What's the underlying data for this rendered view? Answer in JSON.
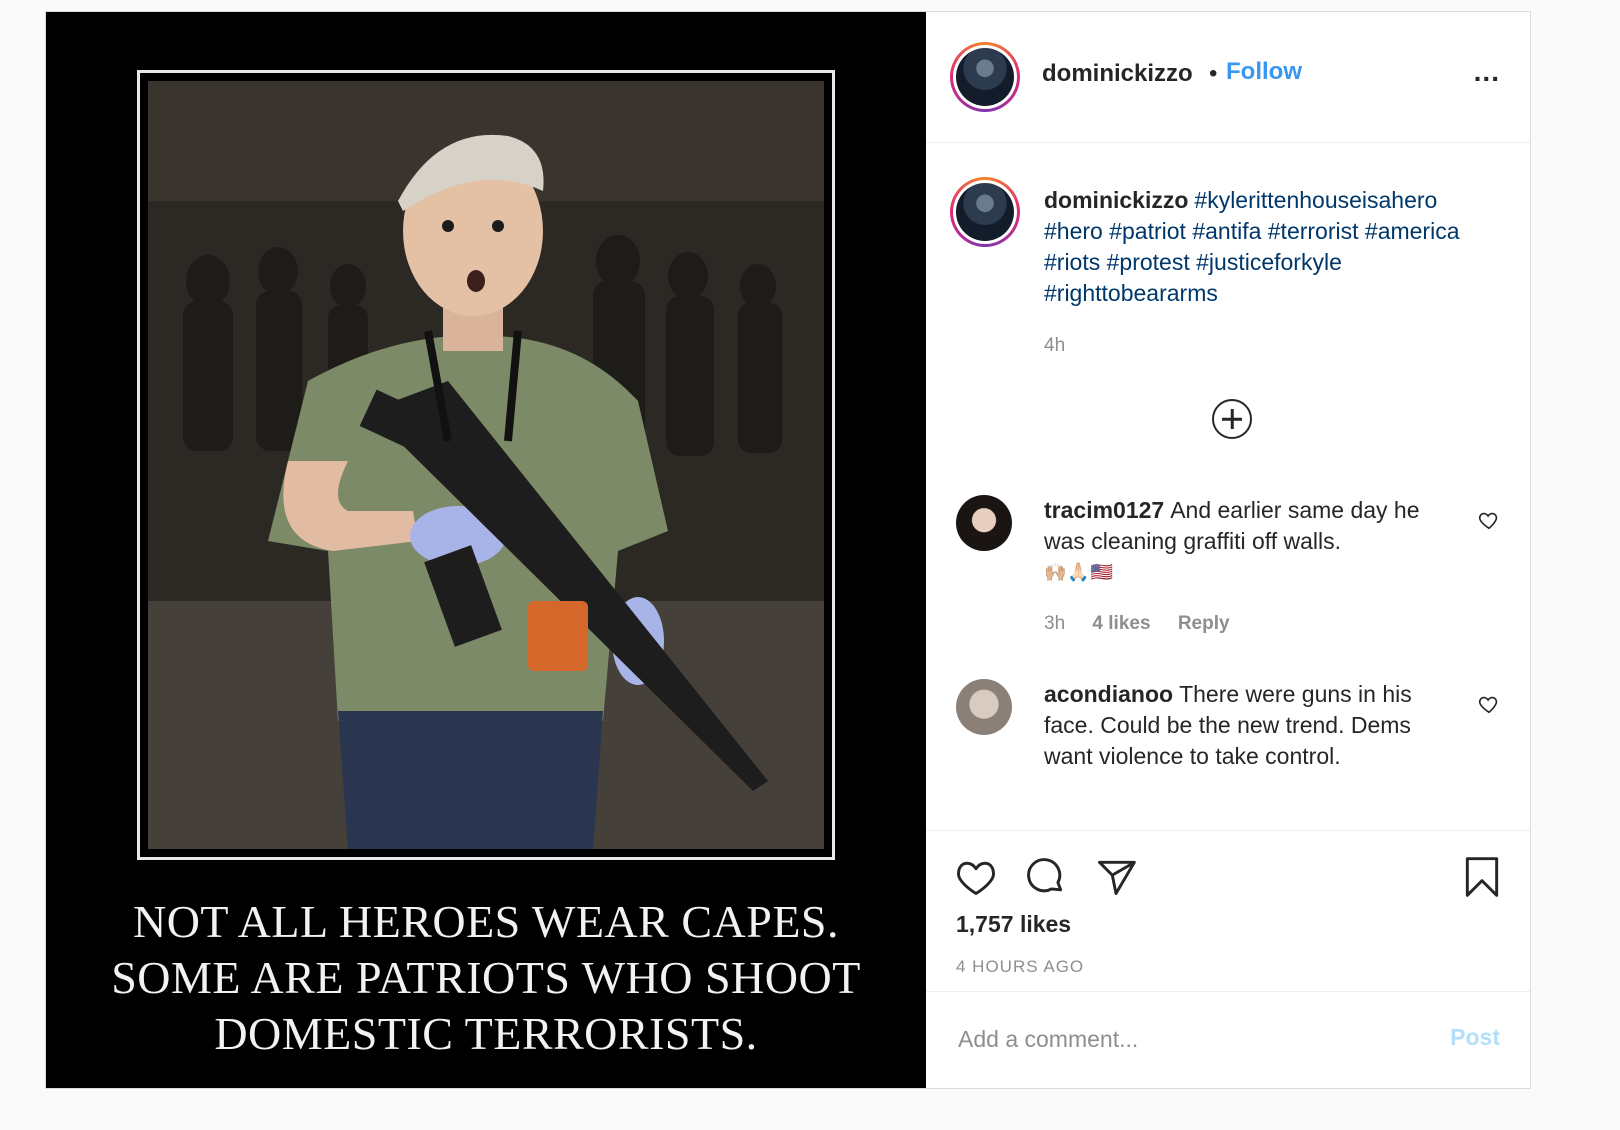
{
  "post": {
    "media": {
      "caption_lines": [
        "NOT ALL HEROES WEAR CAPES.",
        "SOME ARE PATRIOTS WHO SHOOT",
        "DOMESTIC TERRORISTS."
      ]
    },
    "header": {
      "username": "dominickizzo",
      "separator": "•",
      "follow_label": "Follow",
      "more_label": "..."
    },
    "caption": {
      "username": "dominickizzo",
      "hashtags": "#kylerittenhouseisahero #hero #patriot #antifa #terrorist #america #riots #protest #justiceforkyle #righttobeararms",
      "time": "4h"
    },
    "comments": [
      {
        "username": "tracim0127",
        "text": "And earlier same day he was cleaning graffiti off walls.",
        "emoji": "🙌🏼🙏🏻🇺🇸",
        "time": "3h",
        "likes": "4 likes",
        "reply": "Reply"
      },
      {
        "username": "acondianoo",
        "text": "There were guns in his face. Could be the new trend. Dems want violence to take control."
      }
    ],
    "actions": {
      "likes": "1,757 likes",
      "time_ago": "4 HOURS AGO"
    },
    "add_comment": {
      "placeholder": "Add a comment...",
      "post_label": "Post"
    }
  },
  "colors": {
    "link": "#3897f0",
    "hashtag": "#00376b",
    "muted": "#8e8e8e",
    "post_disabled": "#b2dffc"
  }
}
